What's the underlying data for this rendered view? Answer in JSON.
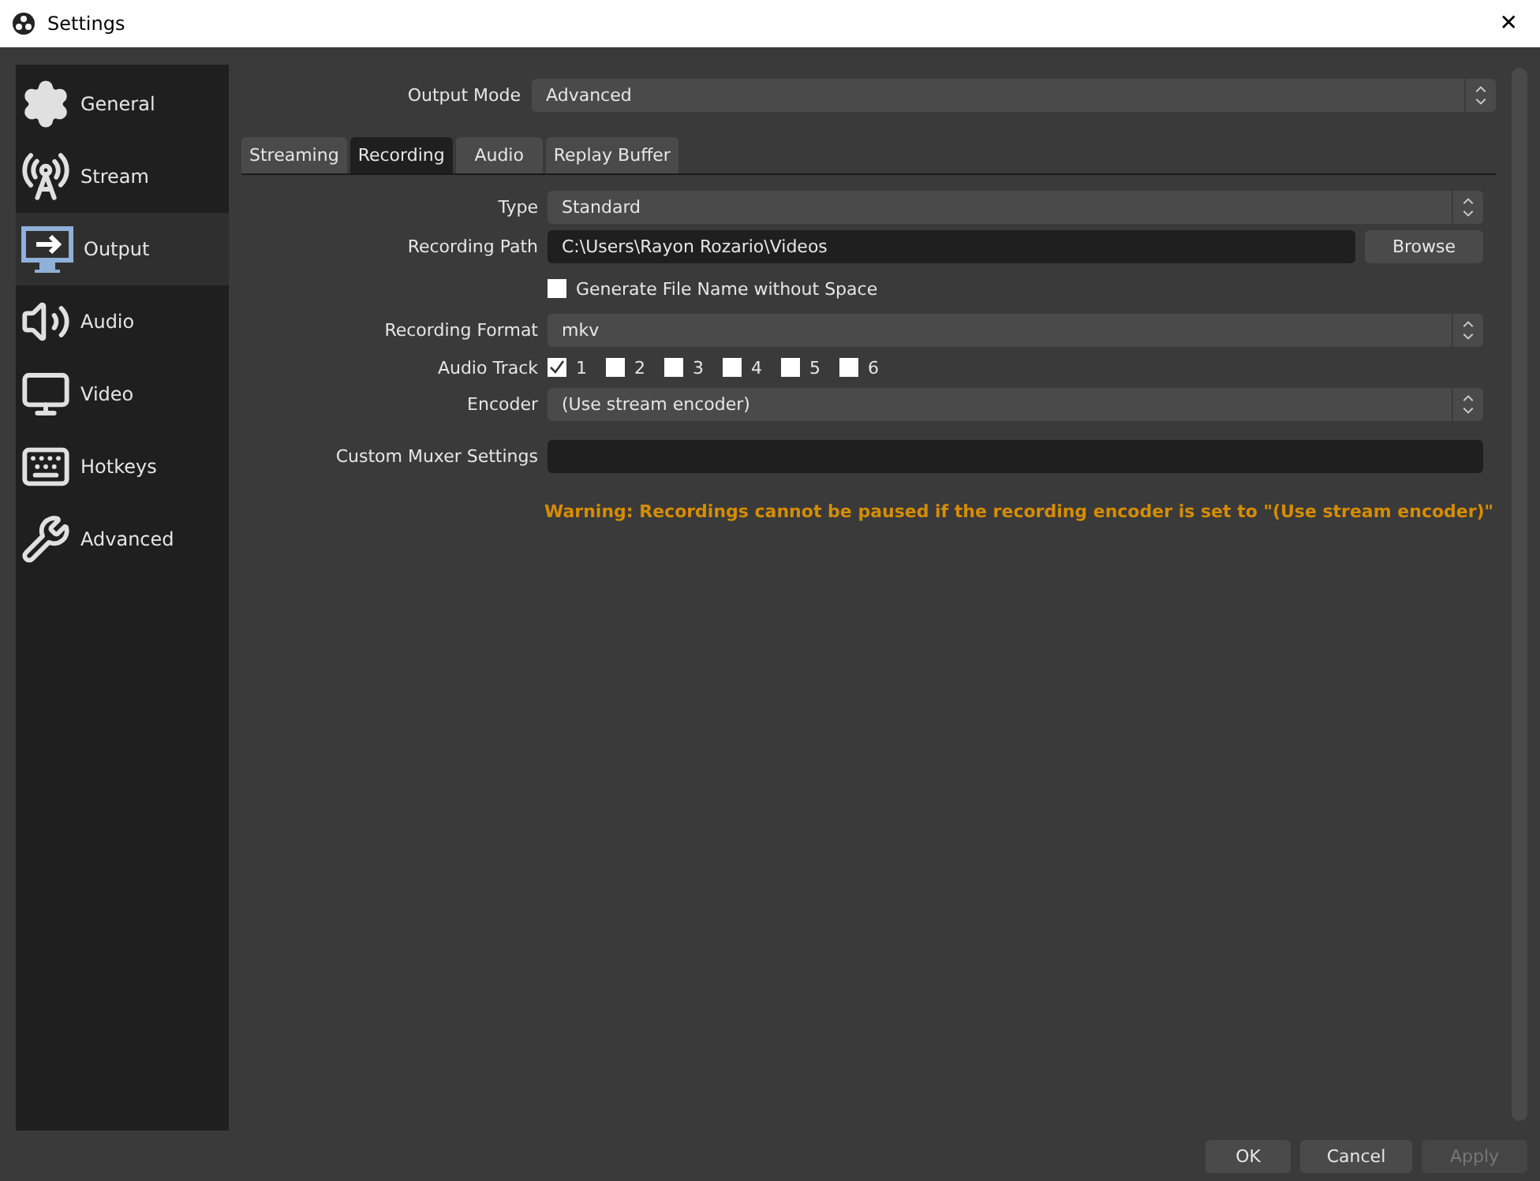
{
  "window": {
    "title": "Settings",
    "close": "✕"
  },
  "sidebar": {
    "items": [
      {
        "label": "General",
        "selected": false
      },
      {
        "label": "Stream",
        "selected": false
      },
      {
        "label": "Output",
        "selected": true
      },
      {
        "label": "Audio",
        "selected": false
      },
      {
        "label": "Video",
        "selected": false
      },
      {
        "label": "Hotkeys",
        "selected": false
      },
      {
        "label": "Advanced",
        "selected": false
      }
    ]
  },
  "output_mode": {
    "label": "Output Mode",
    "value": "Advanced"
  },
  "tabs": [
    {
      "label": "Streaming",
      "selected": false
    },
    {
      "label": "Recording",
      "selected": true
    },
    {
      "label": "Audio",
      "selected": false
    },
    {
      "label": "Replay Buffer",
      "selected": false
    }
  ],
  "form": [
    {
      "kind": "combo",
      "label": "Type",
      "value": "Standard"
    },
    {
      "kind": "path",
      "label": "Recording Path",
      "value": "C:\\Users\\Rayon Rozario\\Videos",
      "button": "Browse"
    },
    {
      "kind": "checkbox",
      "label": "Generate File Name without Space",
      "checked": false
    },
    {
      "kind": "combo",
      "label": "Recording Format",
      "value": "mkv"
    },
    {
      "kind": "tracks",
      "label": "Audio Track",
      "tracks": [
        {
          "label": "1",
          "checked": true
        },
        {
          "label": "2",
          "checked": false
        },
        {
          "label": "3",
          "checked": false
        },
        {
          "label": "4",
          "checked": false
        },
        {
          "label": "5",
          "checked": false
        },
        {
          "label": "6",
          "checked": false
        }
      ]
    },
    {
      "kind": "combo",
      "label": "Encoder",
      "value": "(Use stream encoder)"
    },
    {
      "kind": "text",
      "label": "Custom Muxer Settings"
    }
  ],
  "warning": "Warning: Recordings cannot be paused if the recording encoder is set to \"(Use stream encoder)\"",
  "buttons": [
    {
      "label": "OK",
      "disabled": false
    },
    {
      "label": "Cancel",
      "disabled": false
    },
    {
      "label": "Apply",
      "disabled": true
    }
  ]
}
